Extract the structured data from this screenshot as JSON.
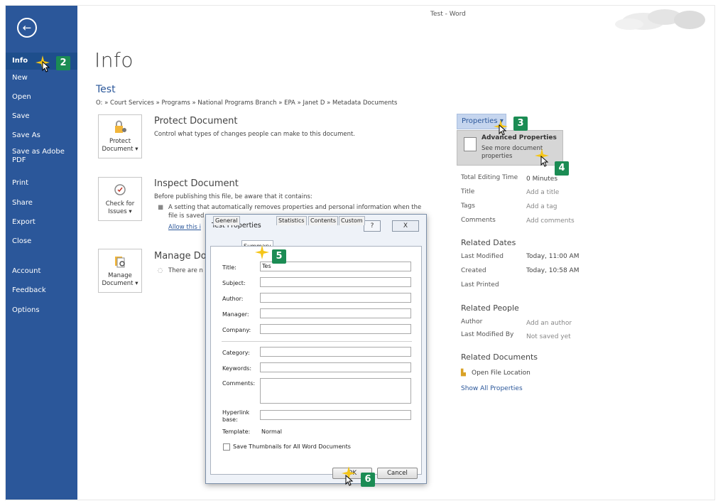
{
  "window": {
    "title": "Test - Word"
  },
  "sidebar": {
    "back_icon": "back-arrow-icon",
    "items": [
      {
        "label": "Info"
      },
      {
        "label": "New"
      },
      {
        "label": "Open"
      },
      {
        "label": "Save"
      },
      {
        "label": "Save As"
      },
      {
        "label": "Save as Adobe PDF"
      },
      {
        "label": "Print"
      },
      {
        "label": "Share"
      },
      {
        "label": "Export"
      },
      {
        "label": "Close"
      },
      {
        "label": "Account"
      },
      {
        "label": "Feedback"
      },
      {
        "label": "Options"
      }
    ]
  },
  "main": {
    "heading": "Info",
    "doc_title": "Test",
    "doc_path": "O: » Court Services » Programs » National Programs Branch » EPA » Janet D » Metadata Documents",
    "protect": {
      "tile_line1": "Protect",
      "tile_line2": "Document ▾",
      "title": "Protect Document",
      "text": "Control what types of changes people can make to this document."
    },
    "inspect": {
      "tile_line1": "Check for",
      "tile_line2": "Issues ▾",
      "title": "Inspect Document",
      "text": "Before publishing this file, be aware that it contains:",
      "bullet1": "A setting that automatically removes properties and personal information when the",
      "bullet2": "file is saved",
      "link": "Allow this i"
    },
    "manage": {
      "tile_line1": "Manage",
      "tile_line2": "Document ▾",
      "title": "Manage Do",
      "text": "There are n"
    }
  },
  "properties": {
    "button": "Properties ▾",
    "advanced_title": "Advanced Properties",
    "advanced_desc": "See more document properties",
    "rows": [
      {
        "label": "Total Editing Time",
        "value": "0 Minutes"
      },
      {
        "label": "Title",
        "value": "Add a title"
      },
      {
        "label": "Tags",
        "value": "Add a tag"
      },
      {
        "label": "Comments",
        "value": "Add comments"
      }
    ],
    "related_dates_heading": "Related Dates",
    "dates": [
      {
        "label": "Last Modified",
        "value": "Today, 11:00 AM"
      },
      {
        "label": "Created",
        "value": "Today, 10:58 AM"
      },
      {
        "label": "Last Printed",
        "value": ""
      }
    ],
    "related_people_heading": "Related People",
    "people": [
      {
        "label": "Author",
        "value": "Add an author"
      },
      {
        "label": "Last Modified By",
        "value": "Not saved yet"
      }
    ],
    "related_docs_heading": "Related Documents",
    "open_location": "Open File Location",
    "show_all": "Show All Properties"
  },
  "dialog": {
    "title": "Test Properties",
    "help": "?",
    "close": "X",
    "tabs": [
      "General",
      "Summary",
      "Statistics",
      "Contents",
      "Custom"
    ],
    "fields": {
      "title": {
        "label": "Title:",
        "value": "Tes"
      },
      "subject": {
        "label": "Subject:",
        "value": ""
      },
      "author": {
        "label": "Author:",
        "value": ""
      },
      "manager": {
        "label": "Manager:",
        "value": ""
      },
      "company": {
        "label": "Company:",
        "value": ""
      },
      "category": {
        "label": "Category:",
        "value": ""
      },
      "keywords": {
        "label": "Keywords:",
        "value": ""
      },
      "comments": {
        "label": "Comments:",
        "value": ""
      },
      "hyperlink_line1": "Hyperlink",
      "hyperlink_line2": "base:",
      "template_label": "Template:",
      "template_value": "Normal"
    },
    "thumbnail_label": "Save Thumbnails for All Word Documents",
    "ok": "OK",
    "cancel": "Cancel"
  },
  "callouts": [
    "2",
    "3",
    "4",
    "5",
    "6"
  ],
  "colors": {
    "sidebar": "#2b579a",
    "badge": "#1b8c54",
    "link": "#2b579a"
  }
}
